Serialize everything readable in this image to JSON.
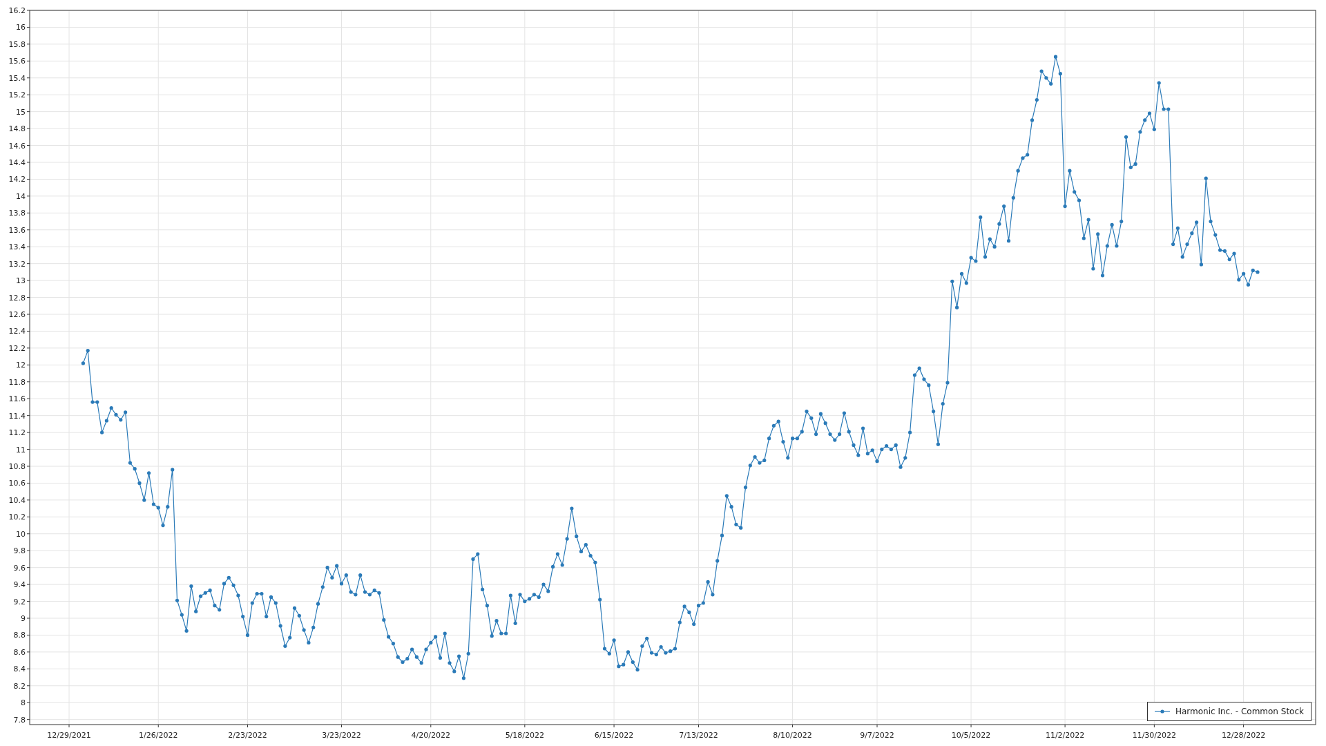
{
  "chart_data": {
    "type": "line",
    "grid": true,
    "ylim": [
      7.74,
      16.2
    ],
    "categories": [
      "12/29/2021",
      null,
      null,
      null,
      null,
      null,
      null,
      null,
      null,
      null,
      null,
      null,
      null,
      null,
      null,
      null,
      null,
      null,
      null,
      "1/26/2022",
      null,
      null,
      null,
      null,
      null,
      null,
      null,
      null,
      null,
      null,
      null,
      null,
      null,
      null,
      null,
      null,
      null,
      null,
      "2/23/2022",
      null,
      null,
      null,
      null,
      null,
      null,
      null,
      null,
      null,
      null,
      null,
      null,
      null,
      null,
      null,
      null,
      null,
      null,
      null,
      "3/23/2022",
      null,
      null,
      null,
      null,
      null,
      null,
      null,
      null,
      null,
      null,
      null,
      null,
      null,
      null,
      null,
      null,
      null,
      null,
      "4/20/2022",
      null,
      null,
      null,
      null,
      null,
      null,
      null,
      null,
      null,
      null,
      null,
      null,
      null,
      null,
      null,
      null,
      null,
      null,
      null,
      "5/18/2022",
      null,
      null,
      null,
      null,
      null,
      null,
      null,
      null,
      null,
      null,
      null,
      null,
      null,
      null,
      null,
      null,
      null,
      null,
      "6/15/2022",
      null,
      null,
      null,
      null,
      null,
      null,
      null,
      null,
      null,
      null,
      null,
      null,
      null,
      null,
      null,
      null,
      null,
      "7/13/2022",
      null,
      null,
      null,
      null,
      null,
      null,
      null,
      null,
      null,
      null,
      null,
      null,
      null,
      null,
      null,
      null,
      null,
      null,
      null,
      "8/10/2022",
      null,
      null,
      null,
      null,
      null,
      null,
      null,
      null,
      null,
      null,
      null,
      null,
      null,
      null,
      null,
      null,
      null,
      "9/7/2022",
      null,
      null,
      null,
      null,
      null,
      null,
      null,
      null,
      null,
      null,
      null,
      null,
      null,
      null,
      null,
      null,
      null,
      null,
      null,
      "10/5/2022",
      null,
      null,
      null,
      null,
      null,
      null,
      null,
      null,
      null,
      null,
      null,
      null,
      null,
      null,
      null,
      null,
      null,
      null,
      null,
      "11/2/2022",
      null,
      null,
      null,
      null,
      null,
      null,
      null,
      null,
      null,
      null,
      null,
      null,
      null,
      null,
      null,
      null,
      null,
      null,
      "11/30/2022",
      null,
      null,
      null,
      null,
      null,
      null,
      null,
      null,
      null,
      null,
      null,
      null,
      null,
      null,
      null,
      null,
      null,
      null,
      "12/28/2022",
      null,
      null,
      null
    ],
    "yticks": [
      7.8,
      8,
      8.2,
      8.4,
      8.6,
      8.8,
      9,
      9.2,
      9.4,
      9.6,
      9.8,
      10,
      10.2,
      10.4,
      10.6,
      10.8,
      11,
      11.2,
      11.4,
      11.6,
      11.8,
      12,
      12.2,
      12.4,
      12.6,
      12.8,
      13,
      13.2,
      13.4,
      13.6,
      13.8,
      14,
      14.2,
      14.4,
      14.6,
      14.8,
      15,
      15.2,
      15.4,
      15.6,
      15.8,
      16,
      16.2
    ],
    "series": [
      {
        "name": "Harmonic Inc. - Common Stock",
        "color": "#2a7ab8",
        "values": [
          null,
          null,
          null,
          12.02,
          12.17,
          11.56,
          11.56,
          11.2,
          11.34,
          11.49,
          11.41,
          11.35,
          11.44,
          10.84,
          10.77,
          10.6,
          10.4,
          10.72,
          10.35,
          10.31,
          10.1,
          10.32,
          10.76,
          9.21,
          9.04,
          8.85,
          9.38,
          9.08,
          9.26,
          9.3,
          9.33,
          9.15,
          9.1,
          9.41,
          9.48,
          9.39,
          9.27,
          9.02,
          8.8,
          9.18,
          9.29,
          9.29,
          9.02,
          9.25,
          9.18,
          8.91,
          8.67,
          8.77,
          9.12,
          9.03,
          8.86,
          8.71,
          8.89,
          9.17,
          9.37,
          9.6,
          9.48,
          9.62,
          9.41,
          9.51,
          9.31,
          9.28,
          9.51,
          9.31,
          9.28,
          9.33,
          9.3,
          8.98,
          8.78,
          8.7,
          8.54,
          8.48,
          8.52,
          8.63,
          8.54,
          8.47,
          8.63,
          8.71,
          8.78,
          8.53,
          8.82,
          8.47,
          8.37,
          8.55,
          8.29,
          8.58,
          9.7,
          9.76,
          9.34,
          9.15,
          8.79,
          8.97,
          8.82,
          8.82,
          9.27,
          8.94,
          9.28,
          9.2,
          9.23,
          9.28,
          9.25,
          9.4,
          9.32,
          9.61,
          9.76,
          9.63,
          9.94,
          10.3,
          9.97,
          9.79,
          9.87,
          9.74,
          9.66,
          9.22,
          8.64,
          8.58,
          8.74,
          8.43,
          8.45,
          8.6,
          8.48,
          8.39,
          8.67,
          8.76,
          8.59,
          8.57,
          8.66,
          8.59,
          8.61,
          8.64,
          8.95,
          9.14,
          9.07,
          8.93,
          9.15,
          9.18,
          9.43,
          9.28,
          9.68,
          9.98,
          10.45,
          10.32,
          10.11,
          10.07,
          10.55,
          10.81,
          10.91,
          10.84,
          10.87,
          11.13,
          11.28,
          11.33,
          11.09,
          10.9,
          11.13,
          11.13,
          11.21,
          11.45,
          11.37,
          11.18,
          11.42,
          11.31,
          11.18,
          11.11,
          11.18,
          11.43,
          11.21,
          11.05,
          10.93,
          11.25,
          10.95,
          10.99,
          10.86,
          11.0,
          11.04,
          11.0,
          11.05,
          10.79,
          10.9,
          11.2,
          11.88,
          11.96,
          11.83,
          11.76,
          11.45,
          11.06,
          11.54,
          11.79,
          12.99,
          12.68,
          13.08,
          12.97,
          13.27,
          13.23,
          13.75,
          13.28,
          13.49,
          13.4,
          13.67,
          13.88,
          13.47,
          13.98,
          14.3,
          14.45,
          14.49,
          14.9,
          15.14,
          15.48,
          15.4,
          15.33,
          15.65,
          15.45,
          13.88,
          14.3,
          14.05,
          13.95,
          13.5,
          13.72,
          13.14,
          13.55,
          13.06,
          13.41,
          13.66,
          13.41,
          13.7,
          14.7,
          14.34,
          14.38,
          14.76,
          14.9,
          14.98,
          14.79,
          15.34,
          15.03,
          15.03,
          13.43,
          13.62,
          13.28,
          13.43,
          13.56,
          13.69,
          13.19,
          14.21,
          13.7,
          13.54,
          13.36,
          13.35,
          13.25,
          13.32,
          13.01,
          13.08,
          12.95,
          13.12,
          13.1
        ]
      }
    ]
  }
}
